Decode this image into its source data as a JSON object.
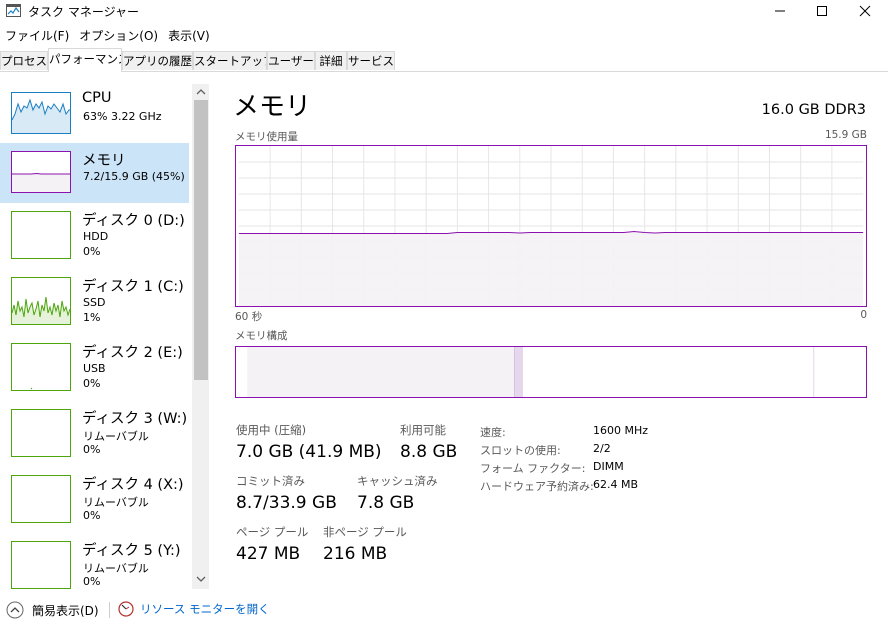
{
  "window": {
    "title": "タスク マネージャー",
    "controls": [
      "minimize-icon",
      "maximize-icon",
      "close-icon"
    ]
  },
  "menu": [
    "ファイル(F)",
    "オプション(O)",
    "表示(V)"
  ],
  "tabs": [
    {
      "label": "プロセス",
      "active": false
    },
    {
      "label": "パフォーマンス",
      "active": true
    },
    {
      "label": "アプリの履歴",
      "active": false
    },
    {
      "label": "スタートアップ",
      "active": false
    },
    {
      "label": "ユーザー",
      "active": false
    },
    {
      "label": "詳細",
      "active": false
    },
    {
      "label": "サービス",
      "active": false
    }
  ],
  "sidebar": {
    "items": [
      {
        "name": "CPU",
        "line1": "63%  3.22 GHz",
        "line2": "",
        "color": "#1a7fc1",
        "selected": false
      },
      {
        "name": "メモリ",
        "line1": "7.2/15.9 GB (45%)",
        "line2": "",
        "color": "#8b12ae",
        "selected": true
      },
      {
        "name": "ディスク 0 (D:)",
        "line1": "HDD",
        "line2": "0%",
        "color": "#4da60c",
        "selected": false
      },
      {
        "name": "ディスク 1 (C:)",
        "line1": "SSD",
        "line2": "1%",
        "color": "#4da60c",
        "selected": false
      },
      {
        "name": "ディスク 2 (E:)",
        "line1": "USB",
        "line2": "0%",
        "color": "#4da60c",
        "selected": false
      },
      {
        "name": "ディスク 3 (W:)",
        "line1": "リムーバブル",
        "line2": "0%",
        "color": "#4da60c",
        "selected": false
      },
      {
        "name": "ディスク 4 (X:)",
        "line1": "リムーバブル",
        "line2": "0%",
        "color": "#4da60c",
        "selected": false
      },
      {
        "name": "ディスク 5 (Y:)",
        "line1": "リムーバブル",
        "line2": "0%",
        "color": "#4da60c",
        "selected": false
      }
    ]
  },
  "main": {
    "title": "メモリ",
    "spec": "16.0 GB DDR3",
    "usage_graph": {
      "label": "メモリ使用量",
      "max_label": "15.9 GB",
      "time_left": "60 秒",
      "time_right": "0",
      "max_gb": 15.9,
      "samples_gb": [
        7.2,
        7.2,
        7.2,
        7.2,
        7.2,
        7.2,
        7.2,
        7.2,
        7.2,
        7.2,
        7.2,
        7.2,
        7.2,
        7.2,
        7.2,
        7.2,
        7.2,
        7.2,
        7.2,
        7.2,
        7.2,
        7.3,
        7.3,
        7.3,
        7.3,
        7.3,
        7.3,
        7.25,
        7.3,
        7.3,
        7.3,
        7.3,
        7.3,
        7.3,
        7.3,
        7.3,
        7.3,
        7.3,
        7.4,
        7.3,
        7.25,
        7.3,
        7.3,
        7.3,
        7.3,
        7.3,
        7.3,
        7.3,
        7.3,
        7.3,
        7.3,
        7.3,
        7.3,
        7.3,
        7.3,
        7.3,
        7.3,
        7.3,
        7.3,
        7.3,
        7.3
      ],
      "line_color": "#8b12ae",
      "fill_color": "#f4f2f4"
    },
    "composition": {
      "label": "メモリ構成",
      "segments": [
        0.44,
        0.013,
        0.48,
        0.067
      ]
    },
    "stats": {
      "in_use_label": "使用中 (圧縮)",
      "in_use_value": "7.0 GB (41.9 MB)",
      "available_label": "利用可能",
      "available_value": "8.8 GB",
      "committed_label": "コミット済み",
      "committed_value": "8.7/33.9 GB",
      "cached_label": "キャッシュ済み",
      "cached_value": "7.8 GB",
      "paged_label": "ページ プール",
      "paged_value": "427 MB",
      "nonpaged_label": "非ページ プール",
      "nonpaged_value": "216 MB"
    },
    "info": [
      {
        "label": "速度:",
        "value": "1600 MHz"
      },
      {
        "label": "スロットの使用:",
        "value": "2/2"
      },
      {
        "label": "フォーム ファクター:",
        "value": "DIMM"
      },
      {
        "label": "ハードウェア予約済み:",
        "value": "62.4 MB"
      }
    ]
  },
  "footer": {
    "fewer_details": "簡易表示(D)",
    "resource_monitor": "リソース モニターを開く",
    "link_color": "#0066cc"
  }
}
